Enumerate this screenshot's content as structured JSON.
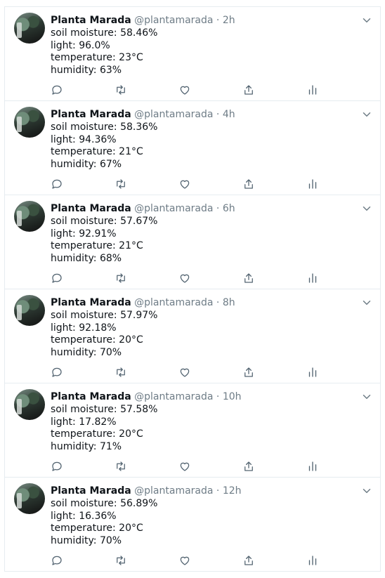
{
  "timeline": {
    "tweets": [
      {
        "name": "Planta Marada",
        "handle": "@plantamarada",
        "separator": "·",
        "time": "2h",
        "soil_moisture": "soil moisture: 58.46%",
        "light": "light: 96.0%",
        "temperature": "temperature: 23°C",
        "humidity": "humidity: 63%"
      },
      {
        "name": "Planta Marada",
        "handle": "@plantamarada",
        "separator": "·",
        "time": "4h",
        "soil_moisture": "soil moisture: 58.36%",
        "light": "light: 94.36%",
        "temperature": "temperature: 21°C",
        "humidity": "humidity: 67%"
      },
      {
        "name": "Planta Marada",
        "handle": "@plantamarada",
        "separator": "·",
        "time": "6h",
        "soil_moisture": "soil moisture: 57.67%",
        "light": "light: 92.91%",
        "temperature": "temperature: 21°C",
        "humidity": "humidity: 68%"
      },
      {
        "name": "Planta Marada",
        "handle": "@plantamarada",
        "separator": "·",
        "time": "8h",
        "soil_moisture": "soil moisture: 57.97%",
        "light": "light: 92.18%",
        "temperature": "temperature: 20°C",
        "humidity": "humidity: 70%"
      },
      {
        "name": "Planta Marada",
        "handle": "@plantamarada",
        "separator": "·",
        "time": "10h",
        "soil_moisture": "soil moisture: 57.58%",
        "light": "light: 17.82%",
        "temperature": "temperature: 20°C",
        "humidity": "humidity: 71%"
      },
      {
        "name": "Planta Marada",
        "handle": "@plantamarada",
        "separator": "·",
        "time": "12h",
        "soil_moisture": "soil moisture: 56.89%",
        "light": "light: 16.36%",
        "temperature": "temperature: 20°C",
        "humidity": "humidity: 70%"
      }
    ]
  },
  "icons": {
    "reply": "reply-icon",
    "retweet": "retweet-icon",
    "like": "heart-icon",
    "share": "share-icon",
    "analytics": "analytics-icon",
    "menu": "chevron-down-icon"
  },
  "colors": {
    "icon": "#536471",
    "muted": "#6e7c86",
    "divider": "#e6ecf0",
    "text": "#0f1419"
  }
}
